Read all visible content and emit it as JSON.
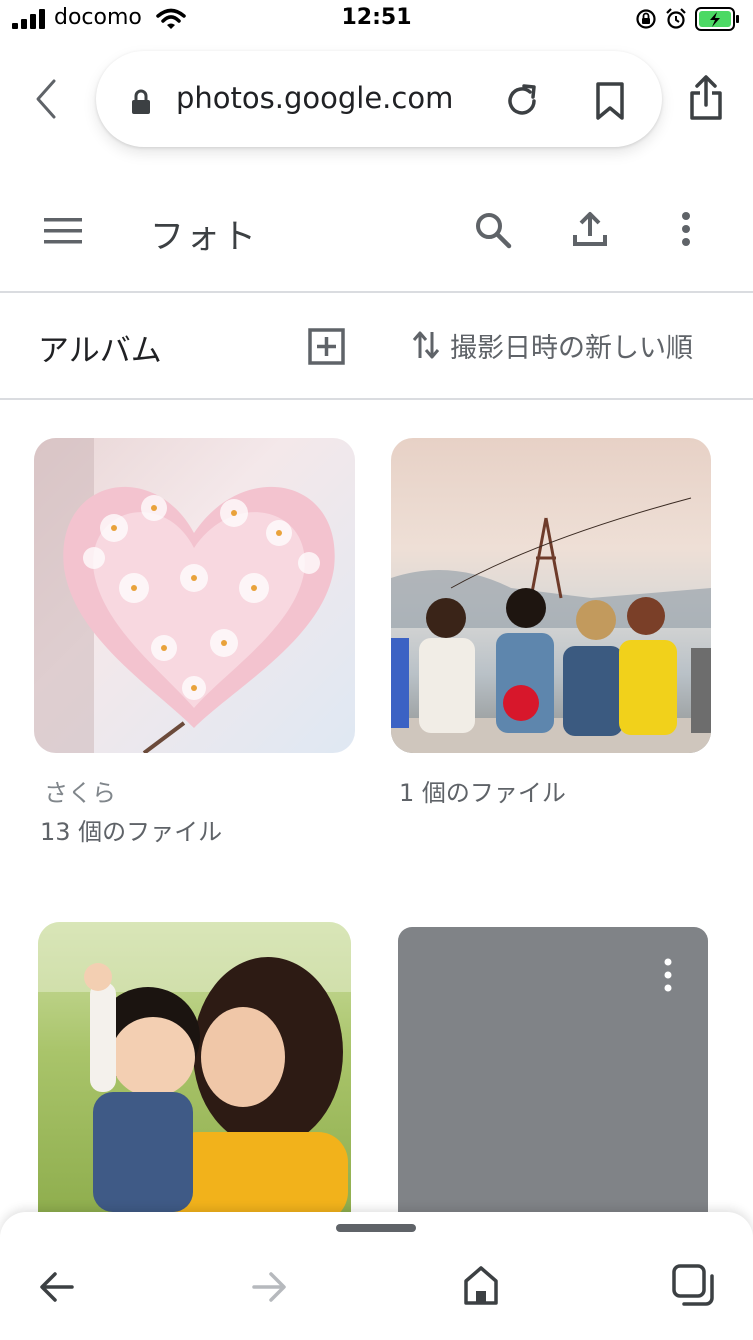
{
  "status_bar": {
    "carrier": "docomo",
    "time": "12:51",
    "battery_color": "#4cd964"
  },
  "browser": {
    "url": "photos.google.com",
    "icons": [
      "chevron-left-icon",
      "lock-icon",
      "reload-icon",
      "bookmark-icon",
      "share-icon"
    ]
  },
  "app_header": {
    "title": "フォト",
    "icons": [
      "menu-icon",
      "search-icon",
      "upload-icon",
      "more-vert-icon"
    ]
  },
  "album_toolbar": {
    "title": "アルバム",
    "sort_label": "撮影日時の新しい順"
  },
  "albums": [
    {
      "name": "さくら",
      "count": "13 個のファイル",
      "image": "cherry blossoms heart"
    },
    {
      "name": "",
      "count": "1 個のファイル",
      "image": "friends at seaside"
    },
    {
      "name": "",
      "count": "",
      "image": "mother kissing child"
    },
    {
      "name": "",
      "count": "",
      "image": "empty album placeholder",
      "placeholder_color": "#808387"
    }
  ],
  "bottom_nav": {
    "icons": [
      "arrow-back-icon",
      "arrow-forward-icon",
      "home-icon",
      "tabs-icon"
    ]
  },
  "colors": {
    "text_primary": "#202124",
    "text_secondary": "#5f6368",
    "divider": "#dadce0"
  }
}
